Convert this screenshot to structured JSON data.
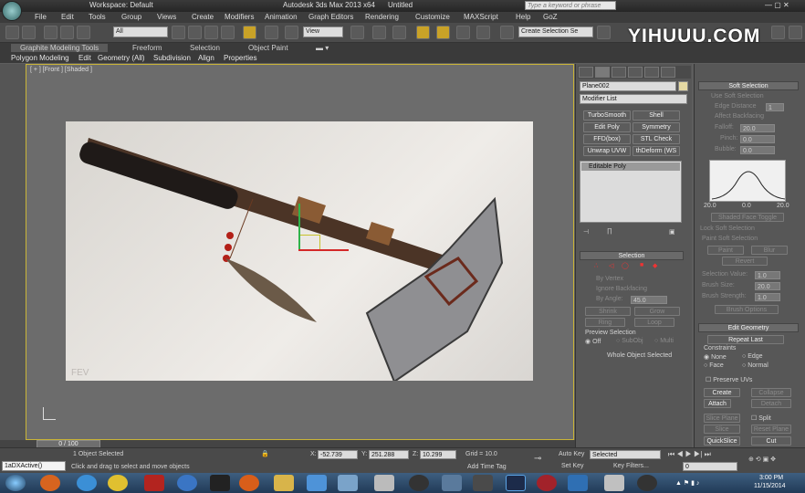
{
  "title_bar": {
    "workspace": "Workspace: Default",
    "app_title": "Autodesk 3ds Max 2013 x64",
    "file": "Untitled",
    "search_placeholder": "Type a keyword or phrase"
  },
  "menu": [
    "File",
    "Edit",
    "Tools",
    "Group",
    "Views",
    "Create",
    "Modifiers",
    "Animation",
    "Graph Editors",
    "Rendering",
    "Customize",
    "MAXScript",
    "Help",
    "GoZ"
  ],
  "toolbar": {
    "filter_select": "All",
    "view_select": "View",
    "selection_set_placeholder": "Create Selection Se"
  },
  "watermark": "YIHUUU.COM",
  "ribbon": {
    "tabs": [
      "Graphite Modeling Tools",
      "Freeform",
      "Selection",
      "Object Paint"
    ],
    "subtabs": [
      "Polygon Modeling",
      "Edit",
      "Geometry (All)",
      "Subdivision",
      "Align",
      "Properties"
    ]
  },
  "viewport": {
    "label": "[ + ] [Front ] [Shaded ]",
    "photo_watermark": "FEV"
  },
  "command_panel": {
    "object_name": "Plane002",
    "modifier_list": "Modifier List",
    "mod_buttons": [
      "TurboSmooth",
      "Shell",
      "Edit Poly",
      "Symmetry",
      "FFD(box)",
      "STL Check",
      "Unwrap UVW",
      "thDeform (WS"
    ],
    "stack_item": "Editable Poly",
    "selection": {
      "header": "Selection",
      "by_vertex": "By Vertex",
      "ignore_backfacing": "Ignore Backfacing",
      "by_angle": "By Angle:",
      "angle_value": "45.0",
      "shrink": "Shrink",
      "grow": "Grow",
      "ring": "Ring",
      "loop": "Loop",
      "preview_header": "Preview Selection",
      "off": "Off",
      "subobj": "SubObj",
      "multi": "Multi",
      "status": "Whole Object Selected"
    }
  },
  "soft_selection": {
    "header": "Soft Selection",
    "use_soft": "Use Soft Selection",
    "edge_distance": "Edge Distance",
    "edge_value": "1",
    "affect_backfacing": "Affect Backfacing",
    "falloff_label": "Falloff:",
    "falloff": "20.0",
    "pinch_label": "Pinch:",
    "pinch": "0.0",
    "bubble_label": "Bubble:",
    "bubble": "0.0",
    "curve_labels": [
      "20.0",
      "0.0",
      "20.0"
    ],
    "shaded_face_toggle": "Shaded Face Toggle",
    "lock_soft": "Lock Soft Selection",
    "paint_header": "Paint Soft Selection",
    "paint": "Paint",
    "blur": "Blur",
    "revert": "Revert",
    "sel_value_label": "Selection Value:",
    "sel_value": "1.0",
    "brush_size_label": "Brush Size:",
    "brush_size": "20.0",
    "brush_strength_label": "Brush Strength:",
    "brush_strength": "1.0",
    "brush_options": "Brush Options"
  },
  "edit_geometry": {
    "header": "Edit Geometry",
    "repeat_last": "Repeat Last",
    "constraints": "Constraints",
    "none": "None",
    "edge": "Edge",
    "face": "Face",
    "normal": "Normal",
    "preserve_uvs": "Preserve UVs",
    "create": "Create",
    "collapse": "Collapse",
    "attach": "Attach",
    "detach": "Detach",
    "slice_plane": "Slice Plane",
    "split": "Split",
    "slice": "Slice",
    "reset_plane": "Reset Plane",
    "quickslice": "QuickSlice",
    "cut": "Cut"
  },
  "timeline": {
    "frame": "0 / 100"
  },
  "status_bar": {
    "script_text": "1aDXActive()",
    "selected": "1 Object Selected",
    "prompt": "Click and drag to select and move objects",
    "x_label": "X:",
    "x": "-52.739",
    "y_label": "Y:",
    "y": "251.288",
    "z_label": "Z:",
    "z": "10.299",
    "grid": "Grid = 10.0",
    "add_time_tag": "Add Time Tag",
    "auto_key": "Auto Key",
    "auto_key_select": "Selected",
    "set_key": "Set Key",
    "key_filters": "Key Filters...",
    "frame_field": "0"
  },
  "taskbar": {
    "time": "3:00 PM",
    "date": "11/15/2014"
  },
  "colors": {
    "viewport_border": "#c9b437",
    "selected_tool": "#c9a227",
    "panel_bg": "#575757"
  }
}
